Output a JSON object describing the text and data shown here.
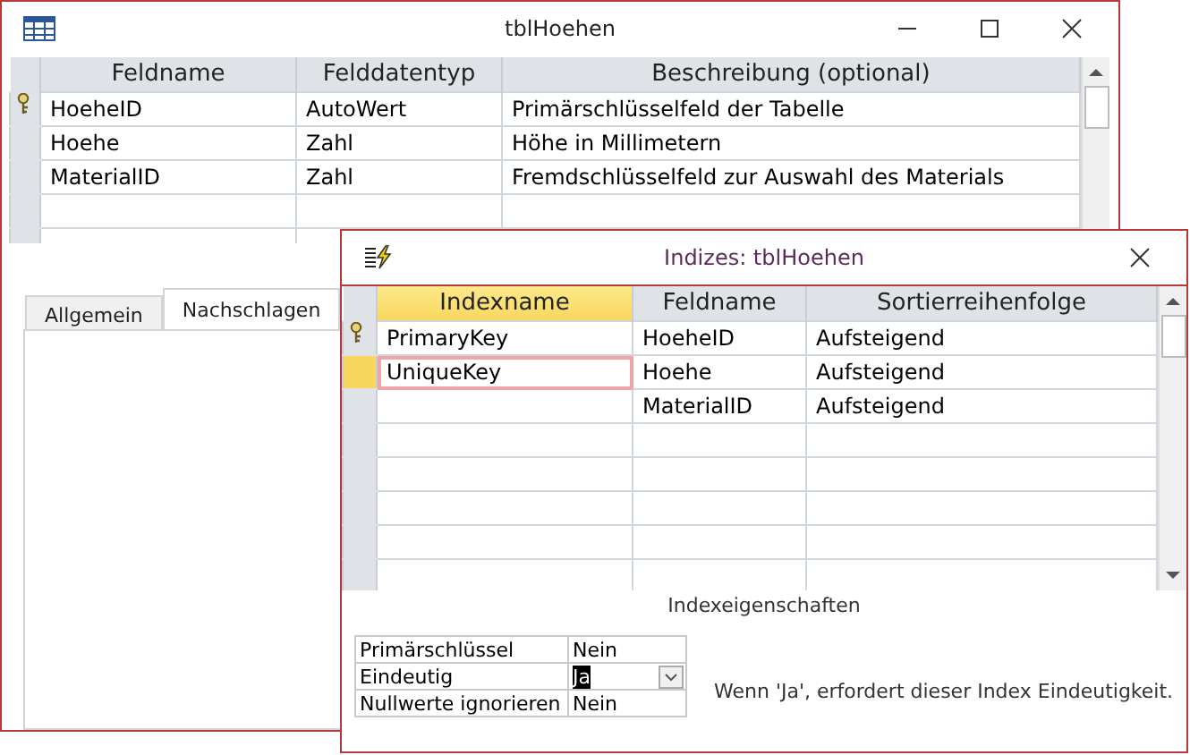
{
  "table_window": {
    "title": "tblHoehen",
    "columns": [
      "Feldname",
      "Felddatentyp",
      "Beschreibung (optional)"
    ],
    "rows": [
      {
        "cells": [
          "HoeheID",
          "AutoWert",
          "Primärschlüsselfeld der Tabelle"
        ],
        "primary_key": true
      },
      {
        "cells": [
          "Hoehe",
          "Zahl",
          "Höhe in Millimetern"
        ],
        "primary_key": false
      },
      {
        "cells": [
          "MaterialID",
          "Zahl",
          "Fremdschlüsselfeld zur Auswahl des Materials"
        ],
        "primary_key": false
      }
    ],
    "tabs": [
      {
        "label": "Allgemein",
        "selected": false
      },
      {
        "label": "Nachschlagen",
        "selected": true
      }
    ]
  },
  "index_window": {
    "title": "Indizes: tblHoehen",
    "columns": [
      "Indexname",
      "Feldname",
      "Sortierreihenfolge"
    ],
    "rows": [
      {
        "cells": [
          "PrimaryKey",
          "HoeheID",
          "Aufsteigend"
        ],
        "primary_key": true,
        "selected": false
      },
      {
        "cells": [
          "UniqueKey",
          "Hoehe",
          "Aufsteigend"
        ],
        "primary_key": false,
        "selected": true
      },
      {
        "cells": [
          "",
          "MaterialID",
          "Aufsteigend"
        ],
        "primary_key": false,
        "selected": false
      }
    ],
    "properties_title": "Indexeigenschaften",
    "properties": [
      {
        "label": "Primärschlüssel",
        "value": "Nein",
        "focused": false
      },
      {
        "label": "Eindeutig",
        "value": "Ja",
        "focused": true
      },
      {
        "label": "Nullwerte ignorieren",
        "value": "Nein",
        "focused": false
      }
    ],
    "help_text": "Wenn 'Ja', erfordert dieser Index Eindeutigkeit."
  }
}
